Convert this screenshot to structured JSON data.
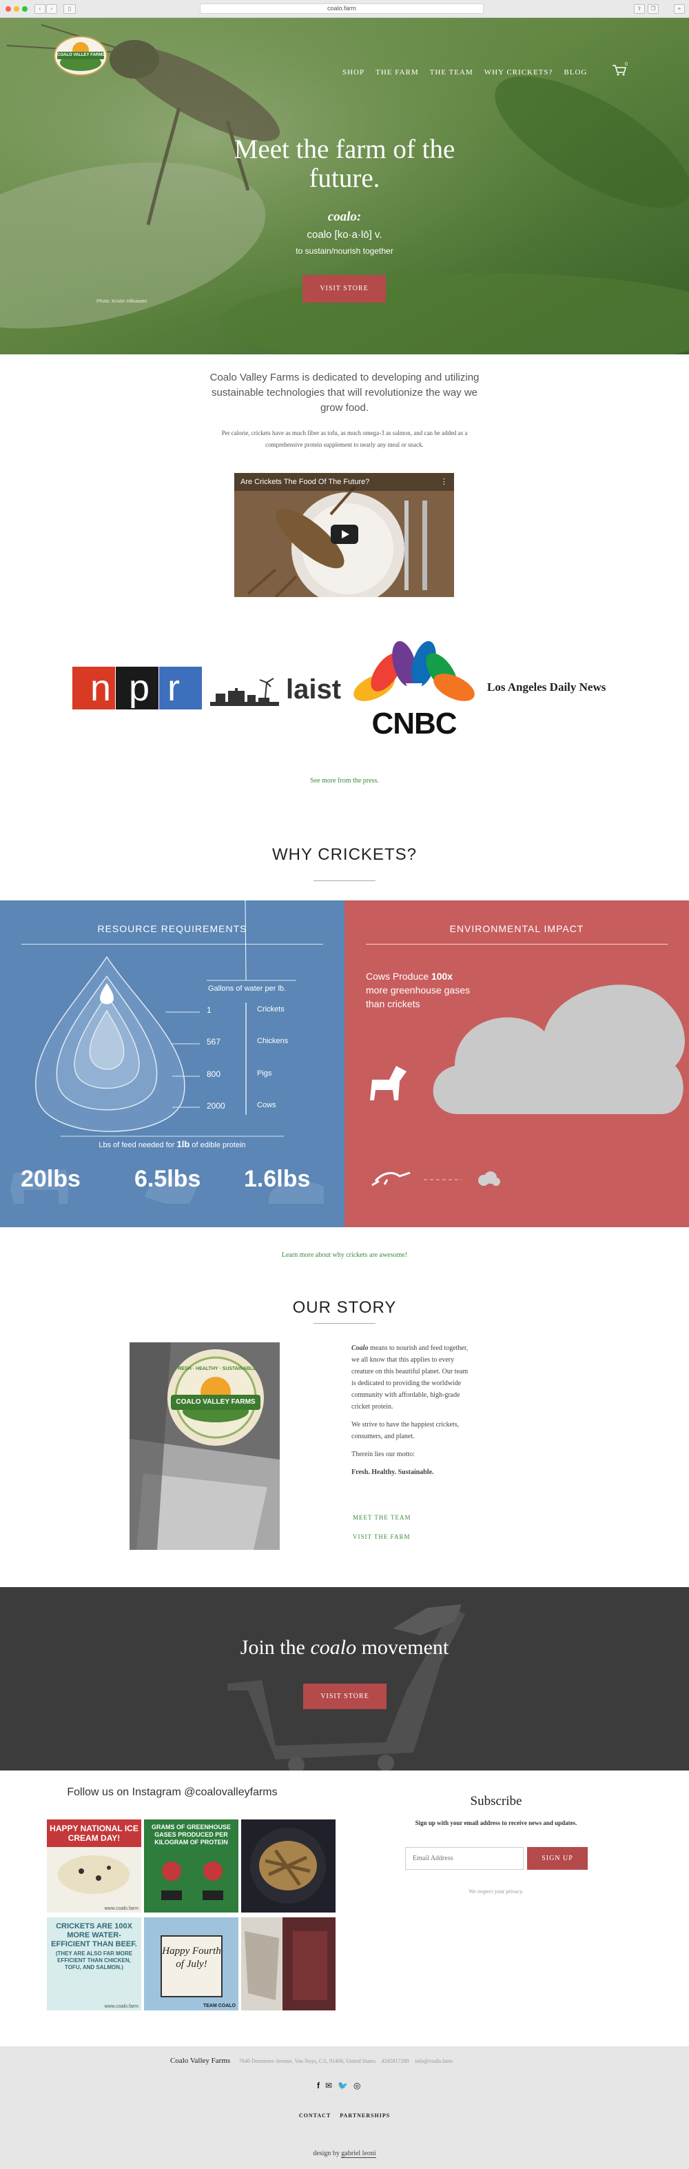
{
  "browser": {
    "url": "coalo.farm"
  },
  "nav": {
    "items": [
      "SHOP",
      "THE FARM",
      "THE TEAM",
      "WHY CRICKETS?",
      "BLOG"
    ],
    "cart_count": "0"
  },
  "logo": {
    "text": "COALO VALLEY FARMS"
  },
  "hero": {
    "title": "Meet the farm of the future.",
    "word": "coalo:",
    "pronunciation": "coalo [ko·a·lō] v.",
    "meaning": "to sustain/nourish together",
    "button": "VISIT STORE",
    "photo_credit": "Photo: Kristin Hillsawen"
  },
  "intro": {
    "lead": "Coalo Valley Farms is dedicated to developing and utilizing sustainable technologies that will revolutionize the way we grow food.",
    "body": "Per calorie, crickets have as much fiber as tofu, as much omega-3 as salmon, and can be added as a comprehensive protein supplement to nearly any meal or snack."
  },
  "video": {
    "title": "Are Crickets The Food Of The Future?"
  },
  "press": {
    "logos": [
      "npr",
      "laist",
      "CNBC",
      "Los Angeles Daily News"
    ],
    "link": "See more from the press."
  },
  "why": {
    "title": "WHY CRICKETS?",
    "resource": {
      "title": "RESOURCE REQUIREMENTS",
      "gallons_label": "Gallons of water per lb.",
      "rows": [
        {
          "value": "1",
          "animal": "Crickets"
        },
        {
          "value": "567",
          "animal": "Chickens"
        },
        {
          "value": "800",
          "animal": "Pigs"
        },
        {
          "value": "2000",
          "animal": "Cows"
        }
      ],
      "feed_label_pre": "Lbs of feed needed for",
      "feed_label_bold": "1lb",
      "feed_label_post": "of edible protein",
      "feed_values": [
        "20lbs",
        "6.5lbs",
        "1.6lbs"
      ]
    },
    "environment": {
      "title": "ENVIRONMENTAL IMPACT",
      "pre": "Cows Produce",
      "bold": "100x",
      "post": "more greenhouse gases than crickets"
    },
    "link": "Learn more about why crickets are awesome!"
  },
  "story": {
    "title": "OUR STORY",
    "p1_em": "Coalo",
    "p1": "means to nourish and feed together, we all know that this applies to every creature on this beautiful planet. Our team is dedicated to providing the worldwide community with affordable, high-grade cricket protein.",
    "p2": "We strive to have the happiest crickets, consumers, and planet.",
    "p3": "Therein lies our motto:",
    "motto": "Fresh. Healthy. Sustainable.",
    "link_team": "MEET THE TEAM",
    "link_farm": "VISIT THE FARM",
    "label_image": "FRESH · HEALTHY · SUSTAINABLE"
  },
  "join": {
    "pre": "Join the",
    "em": "coalo",
    "post": "movement",
    "button": "VISIT STORE"
  },
  "instagram": {
    "title": "Follow us on Instagram @coalovalleyfarms",
    "posts": [
      {
        "text": "HAPPY NATIONAL ICE CREAM DAY!",
        "footer": "www.coalo.farm"
      },
      {
        "text": "GRAMS OF GREENHOUSE GASES PRODUCED PER KILOGRAM OF PROTEIN"
      },
      {
        "text": ""
      },
      {
        "text": "CRICKETS ARE 100X MORE WATER-EFFICIENT THAN BEEF.",
        "sub": "(THEY ARE ALSO FAR MORE EFFICIENT THAN CHICKEN, TOFU, AND SALMON.)",
        "footer": "www.coalo.farm"
      },
      {
        "text": "Happy Fourth of July!",
        "footer": "TEAM COALO"
      },
      {
        "text": ""
      }
    ]
  },
  "subscribe": {
    "title": "Subscribe",
    "desc": "Sign up with your email address to receive news and updates.",
    "placeholder": "Email Address",
    "button": "SIGN UP",
    "privacy": "We respect your privacy."
  },
  "footer": {
    "name": "Coalo Valley Farms",
    "address": "7646 Densmore Avenue, Van Nuys, CA, 91406, United States",
    "phone": "4245817289",
    "email": "info@coalo.farm",
    "links": [
      "CONTACT",
      "PARTNERSHIPS"
    ],
    "credit_pre": "design by",
    "credit_name": "gabriel leoni"
  },
  "colors": {
    "blue_panel": "#5b86b5",
    "red_panel": "#c85d5e",
    "button": "#b44a4a",
    "dark": "#3c3c3c",
    "link_green": "#3b8a3b"
  }
}
